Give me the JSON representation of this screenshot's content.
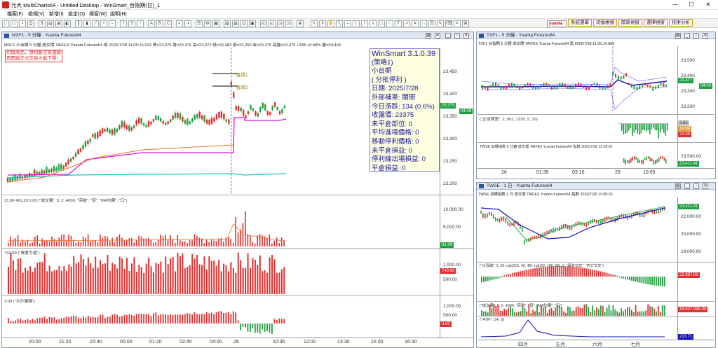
{
  "titlebar": {
    "title": "元大 MultiCharts64 - Untitled Desktop - WinSmart_台指期(日)_1",
    "min": "—",
    "max": "☐",
    "close": "✕"
  },
  "menu": [
    "檔案(F)",
    "檢視(V)",
    "新增(I)",
    "設定(O)",
    "視窗(W)",
    "說明(H)"
  ],
  "toolbar": {
    "symbol_select": "yuanta",
    "right_buttons": [
      "系統選單",
      "切換帳號",
      "開新視窗",
      "選擇視窗",
      "技術分析"
    ]
  },
  "left_pane": {
    "title": "MXF1 - 5 分鐘 - Yuanta Futures64",
    "info": "MXF1  小台期  5 分鐘  成交價  TAIFEX  Yuanta Futures64  周  2025/7/28  11:05:15.632  買=23,375  賣=23,376  高=23,372  低=23,483  低=23,265  收=23,375  高盤=23,375  +338  +0.68%  量=69,404",
    "warning_line1": "切換商品，請切斷交易連線",
    "warning_line2": "再開啟正式交易才能下單!",
    "winsmart": {
      "title": "WinSmart 3.1.0.39",
      "lines": [
        "(策略1)",
        "小台期",
        "( 分批停利 )",
        "日期: 2025/7/28",
        "外部補單: 關閉",
        "今日漲跌: 134 (0.6%)",
        "收盤價: 23375",
        "未平倉部位: 0",
        "平均進場價格: 0",
        "移動停利價格: 0",
        "未平倉損益: 0",
        "停利線出場損益: 0",
        "平倉損益 :0"
      ]
    },
    "markers": [
      "進場1",
      "進場2"
    ],
    "price_axis": [
      "23,450",
      "23,400",
      "23,350",
      "23,300",
      "23,250",
      "23,200"
    ],
    "price_box_last": "23,375",
    "price_box_time": "04:48",
    "vol_info": "31.00  461.20  0.00  (\"成交量\", 5, 2, 4000, \"突破\", \"倍\", \"MA均量\", \"口\")",
    "vol_axis": [
      "10,000.00",
      "5,000.00"
    ],
    "vol_box": "31.00",
    "buysell_info": "743.00  (\"買賣力道\")",
    "buysell_axis": [
      "1,000.00",
      "500.00"
    ],
    "buysell_box": "743.00",
    "big_info": "3.00  (\"大戶籌碼\")",
    "big_axis": [
      "1,000.00",
      "500.00"
    ],
    "big_box": "3.00",
    "time_axis": [
      "20:00",
      "21:20",
      "22:40",
      "00:00",
      "01:20",
      "02:40",
      "04:00",
      "28",
      "10:35",
      "12:00",
      "13:30",
      "15:00",
      "16:30"
    ]
  },
  "right_top_pane": {
    "title": "TXF1 - 5 分鐘 - Yuanta Futures64",
    "info": "TXF1  台指期  5 分鐘  成交價  TAIFEX  Yuanta Futures64  周  2025/7/28  11:05:14.989",
    "price_axis": [
      "23,500",
      "23,400",
      "23,300",
      "23,200"
    ],
    "price_box": "23,377",
    "price_box_time": "04:40",
    "sub_info": "(\"正逆價差\", 2, 901, 1330, 5, 10)",
    "sub_boxes": [
      "3.85",
      "19.98",
      "73.35"
    ],
    "twse_info": "TWSE  加權指數  5 分鐘  成交價  TAIFEX  Yuanta Futures64  指數  2025/7/28  11:05:20",
    "twse_axis": [
      "23,500.00"
    ],
    "twse_box": "23,411.41",
    "time_axis": [
      "26",
      "01:35",
      "03:10",
      "28",
      "10:05"
    ]
  },
  "right_bottom_pane": {
    "title": "TWSE - 1 日 - Yuanta Futures64",
    "info": "TWSE  加權指數  1 日  成交價  TAIFEX  Yuanta Futures64  指數  2025/7/28  11:05:20",
    "price_axis": [
      "22,000.00",
      "20,000.00",
      "18,000.00"
    ],
    "price_box": "23,411.41",
    "bull_info": "(\"水母線\", 5, 20, rgb(215, 40, 45), rgb(33, 180, 66), 2, \"黃金交叉\", \"死亡交叉\")",
    "bull_box": "22,897.06",
    "vol_info": "(\"成交量\", 5, 2, 4000, \"突破\", \"倍\", \"MA均量\", \"口\")",
    "vol_box": "18,507,986.00",
    "atr_info": "(\"ATR\", 14, 0)",
    "atr_box": "213.71",
    "time_axis": [
      "四月",
      "五月",
      "六月",
      "七月"
    ]
  },
  "colors": {
    "up": "#e03030",
    "down": "#20a040",
    "magenta": "#e010e0",
    "orange": "#f07020",
    "cyan": "#20c0c0",
    "blue": "#1010c0",
    "accent": "#2b55a0"
  }
}
